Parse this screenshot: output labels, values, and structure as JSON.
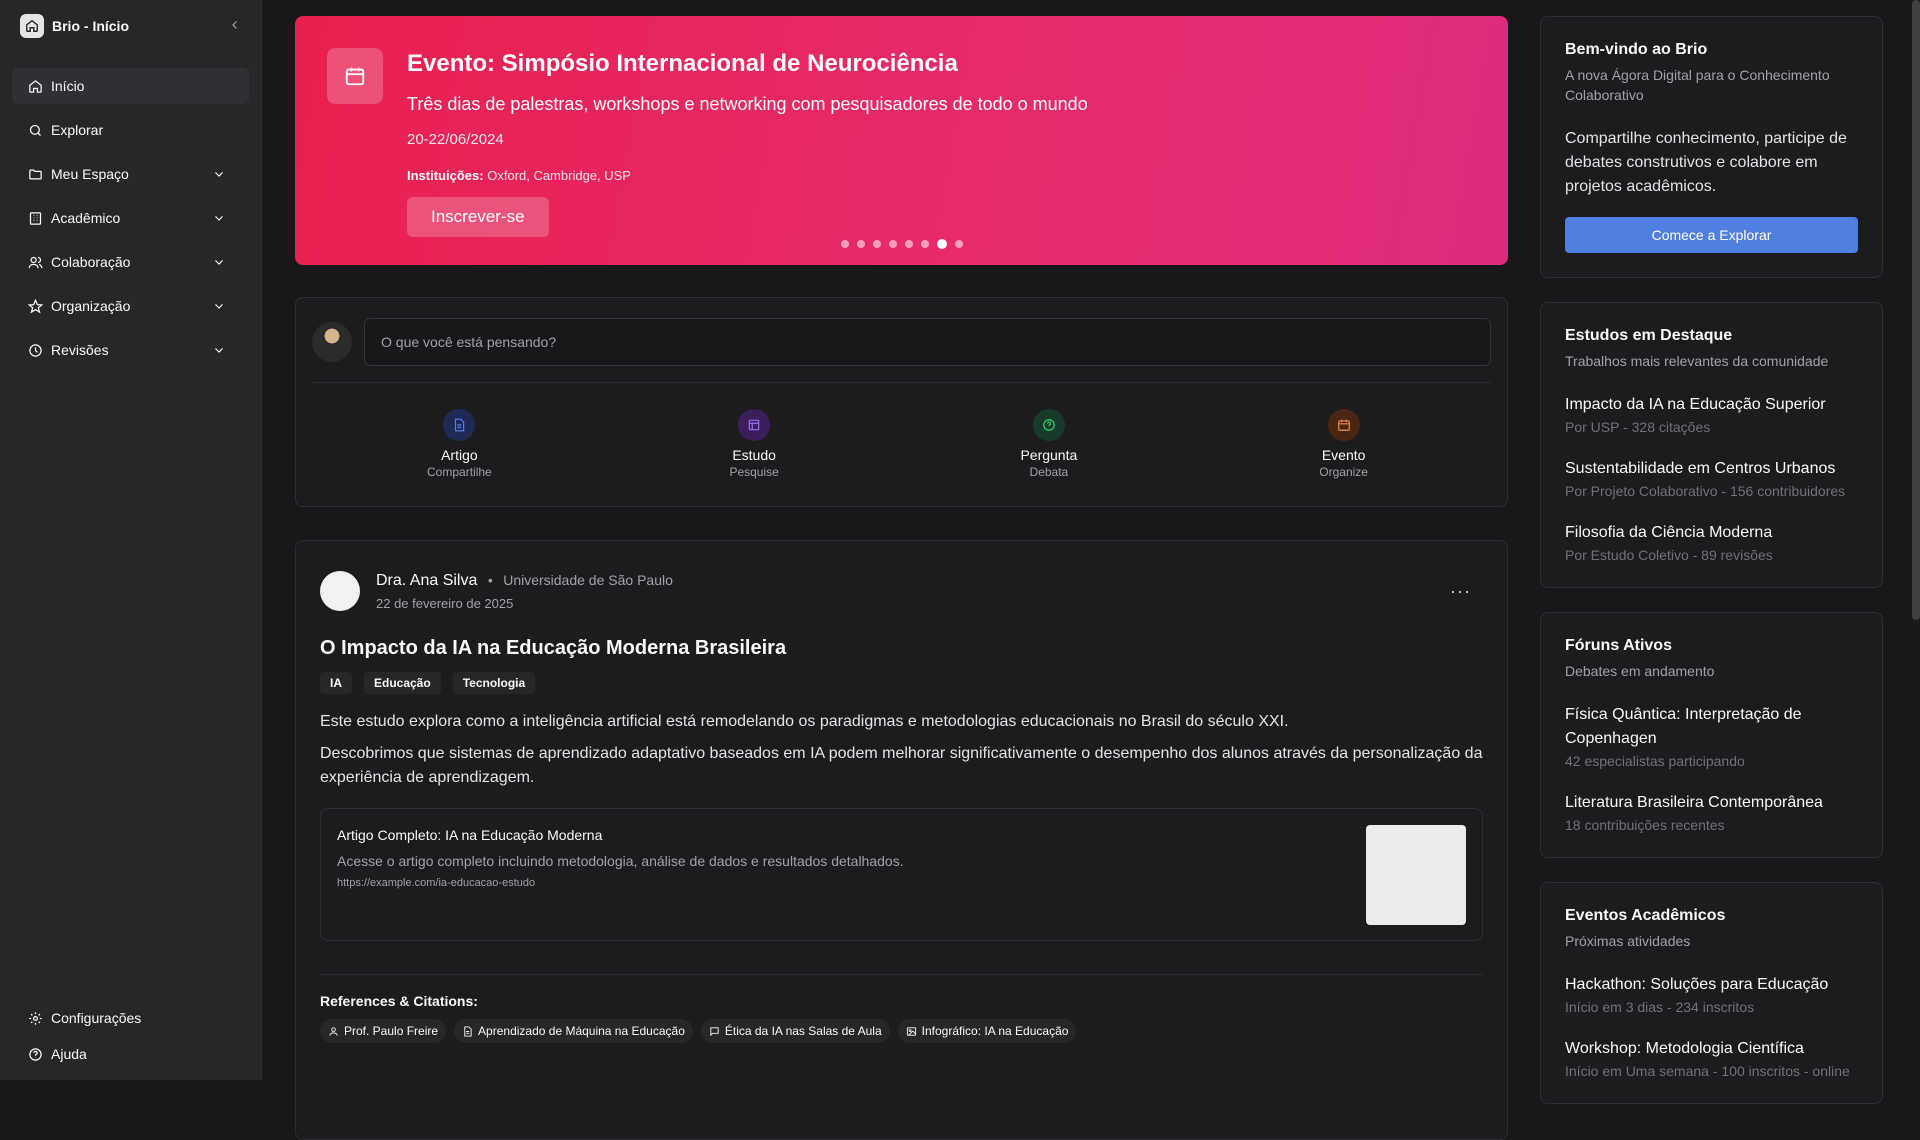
{
  "sidebar": {
    "title": "Brio - Início",
    "nav": [
      {
        "label": "Início",
        "icon": "home-icon"
      },
      {
        "label": "Explorar",
        "icon": "search-icon"
      },
      {
        "label": "Meu Espaço",
        "icon": "folder-icon"
      },
      {
        "label": "Acadêmico",
        "icon": "building-icon"
      },
      {
        "label": "Colaboração",
        "icon": "users-icon"
      },
      {
        "label": "Organização",
        "icon": "star-icon"
      },
      {
        "label": "Revisões",
        "icon": "clock-icon"
      }
    ],
    "footer": [
      {
        "label": "Configurações",
        "icon": "gear-icon"
      },
      {
        "label": "Ajuda",
        "icon": "help-icon"
      }
    ]
  },
  "banner": {
    "title": "Evento: Simpósio Internacional de Neurociência",
    "subtitle": "Três dias de palestras, workshops e networking com pesquisadores de todo o mundo",
    "date": "20-22/06/2024",
    "institutions_label": "Instituições:",
    "institutions": "Oxford, Cambridge, USP",
    "button": "Inscrever-se",
    "slides": 8,
    "active_slide": 7,
    "color": "#e8204f"
  },
  "composer": {
    "placeholder": "O que você está pensando?",
    "actions": [
      {
        "label": "Artigo",
        "sub": "Compartilhe",
        "icon": "document-icon",
        "color": "#3b5bdb"
      },
      {
        "label": "Estudo",
        "sub": "Pesquise",
        "icon": "layout-icon",
        "color": "#7c3aed"
      },
      {
        "label": "Pergunta",
        "sub": "Debata",
        "icon": "question-icon",
        "color": "#22c55e"
      },
      {
        "label": "Evento",
        "sub": "Organize",
        "icon": "calendar-icon",
        "color": "#f97316"
      }
    ]
  },
  "post": {
    "author": "Dra. Ana Silva",
    "separator": "•",
    "institution": "Universidade de São Paulo",
    "date": "22 de fevereiro de 2025",
    "more": "···",
    "title": "O Impacto da IA na Educação Moderna Brasileira",
    "tags": [
      "IA",
      "Educação",
      "Tecnologia"
    ],
    "body1": "Este estudo explora como a inteligência artificial está remodelando os paradigmas e metodologias educacionais no Brasil do século XXI.",
    "body2": "Descobrimos que sistemas de aprendizado adaptativo baseados em IA podem melhorar significativamente o desempenho dos alunos através da personalização da experiência de aprendizagem.",
    "link": {
      "title": "Artigo Completo: IA na Educação Moderna",
      "desc": "Acesse o artigo completo incluindo metodologia, análise de dados e resultados detalhados.",
      "url": "https://example.com/ia-educacao-estudo"
    },
    "refs_title": "References & Citations:",
    "refs": [
      {
        "label": "Prof. Paulo Freire",
        "icon": "person-icon"
      },
      {
        "label": "Aprendizado de Máquina na Educação",
        "icon": "document-icon"
      },
      {
        "label": "Ética da IA nas Salas de Aula",
        "icon": "chat-icon"
      },
      {
        "label": "Infográfico: IA na Educação",
        "icon": "image-icon"
      }
    ]
  },
  "right": {
    "welcome": {
      "title": "Bem-vindo ao Brio",
      "subtitle": "A nova Ágora Digital para o Conhecimento Colaborativo",
      "text": "Compartilhe conhecimento, participe de debates construtivos e colabore em projetos acadêmicos.",
      "button": "Comece a Explorar"
    },
    "studies": {
      "title": "Estudos em Destaque",
      "subtitle": "Trabalhos mais relevantes da comunidade",
      "items": [
        {
          "title": "Impacto da IA na Educação Superior",
          "meta": "Por USP - 328 citações"
        },
        {
          "title": "Sustentabilidade em Centros Urbanos",
          "meta": "Por Projeto Colaborativo - 156 contribuidores"
        },
        {
          "title": "Filosofia da Ciência Moderna",
          "meta": "Por Estudo Coletivo - 89 revisões"
        }
      ]
    },
    "forums": {
      "title": "Fóruns Ativos",
      "subtitle": "Debates em andamento",
      "items": [
        {
          "title": "Física Quântica: Interpretação de Copenhagen",
          "meta": "42 especialistas participando"
        },
        {
          "title": "Literatura Brasileira Contemporânea",
          "meta": "18 contribuições recentes"
        }
      ]
    },
    "events": {
      "title": "Eventos Acadêmicos",
      "subtitle": "Próximas atividades",
      "items": [
        {
          "title": "Hackathon: Soluções para Educação",
          "meta": "Início em 3 dias - 234 inscritos"
        },
        {
          "title": "Workshop: Metodologia Científica",
          "meta": "Início em Uma semana - 100 inscritos - online"
        }
      ]
    }
  }
}
